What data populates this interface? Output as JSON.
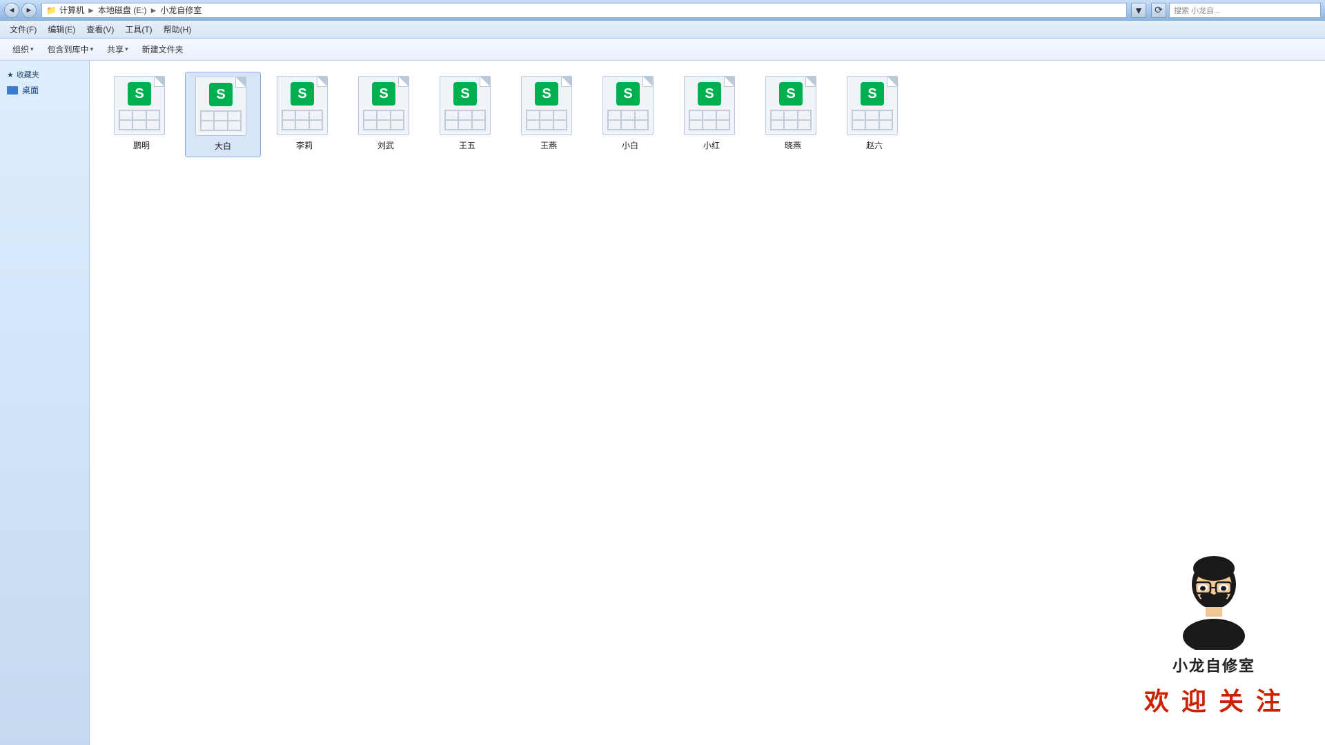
{
  "titlebar": {
    "path": [
      "计算机",
      "本地磁盘 (E:)",
      "小龙自修室"
    ],
    "search_placeholder": "搜索 小龙自...",
    "back_label": "◄",
    "forward_label": "►",
    "refresh_label": "⟳",
    "dropdown_label": "▼"
  },
  "menubar": {
    "items": [
      {
        "id": "file",
        "label": "文件(F)"
      },
      {
        "id": "edit",
        "label": "编辑(E)"
      },
      {
        "id": "view",
        "label": "查看(V)"
      },
      {
        "id": "tools",
        "label": "工具(T)"
      },
      {
        "id": "help",
        "label": "帮助(H)"
      }
    ]
  },
  "toolbar": {
    "items": [
      {
        "id": "organize",
        "label": "组织"
      },
      {
        "id": "include-in-library",
        "label": "包含到库中"
      },
      {
        "id": "share",
        "label": "共享"
      },
      {
        "id": "new-folder",
        "label": "新建文件夹"
      }
    ]
  },
  "sidebar": {
    "favorites_label": "收藏夹",
    "desktop_label": "桌面"
  },
  "files": [
    {
      "id": "file-1",
      "name": "鹏明"
    },
    {
      "id": "file-2",
      "name": "大白",
      "selected": true
    },
    {
      "id": "file-3",
      "name": "李莉"
    },
    {
      "id": "file-4",
      "name": "刘武"
    },
    {
      "id": "file-5",
      "name": "王五"
    },
    {
      "id": "file-6",
      "name": "王燕"
    },
    {
      "id": "file-7",
      "name": "小白"
    },
    {
      "id": "file-8",
      "name": "小红"
    },
    {
      "id": "file-9",
      "name": "晓燕"
    },
    {
      "id": "file-10",
      "name": "赵六"
    }
  ],
  "watermark": {
    "title": "小龙自修室",
    "slogan": "欢 迎 关 注"
  }
}
